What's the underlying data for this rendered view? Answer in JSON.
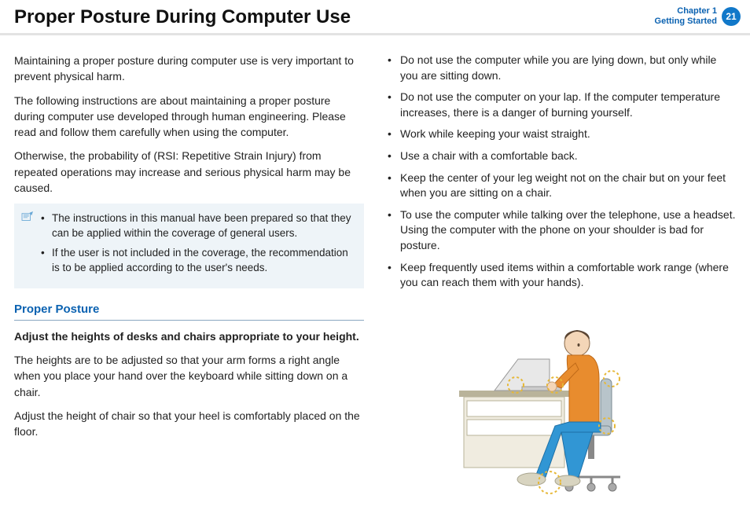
{
  "header": {
    "title": "Proper Posture During Computer Use",
    "chapter_line1": "Chapter 1",
    "chapter_line2": "Getting Started",
    "page_num": "21"
  },
  "left": {
    "p1": "Maintaining a proper posture during computer use is very important to prevent physical harm.",
    "p2": "The following instructions are about maintaining a proper posture during computer use developed through human engineering. Please read and follow them carefully when using the computer.",
    "p3": "Otherwise, the probability of (RSI: Repetitive Strain Injury) from repeated operations may increase and serious physical harm may be caused.",
    "note": [
      "The instructions in this manual have been prepared so that they can be applied within the coverage of general users.",
      "If the user is not included in the coverage, the recommendation is to be applied according to the user's needs."
    ],
    "section_head": "Proper Posture",
    "subhead": "Adjust the heights of desks and chairs appropriate to your height.",
    "p4": "The heights are to be adjusted so that your arm forms a right angle when you place your hand over the keyboard while sitting down on a chair.",
    "p5": "Adjust the height of chair so that your heel is comfortably placed on the floor."
  },
  "right": {
    "bullets": [
      "Do not use the computer while you are lying down, but only while you are sitting down.",
      "Do not use the computer on your lap. If the computer temperature increases, there is a danger of burning yourself.",
      "Work while keeping your waist straight.",
      "Use a chair with a comfortable back.",
      "Keep the center of your leg weight not on the chair but on your feet when you are sitting on a chair.",
      "To use the computer while talking over the telephone, use a headset. Using the computer with the phone on your shoulder is bad for posture.",
      "Keep frequently used items within a comfortable work range (where you can reach them with your hands)."
    ]
  }
}
